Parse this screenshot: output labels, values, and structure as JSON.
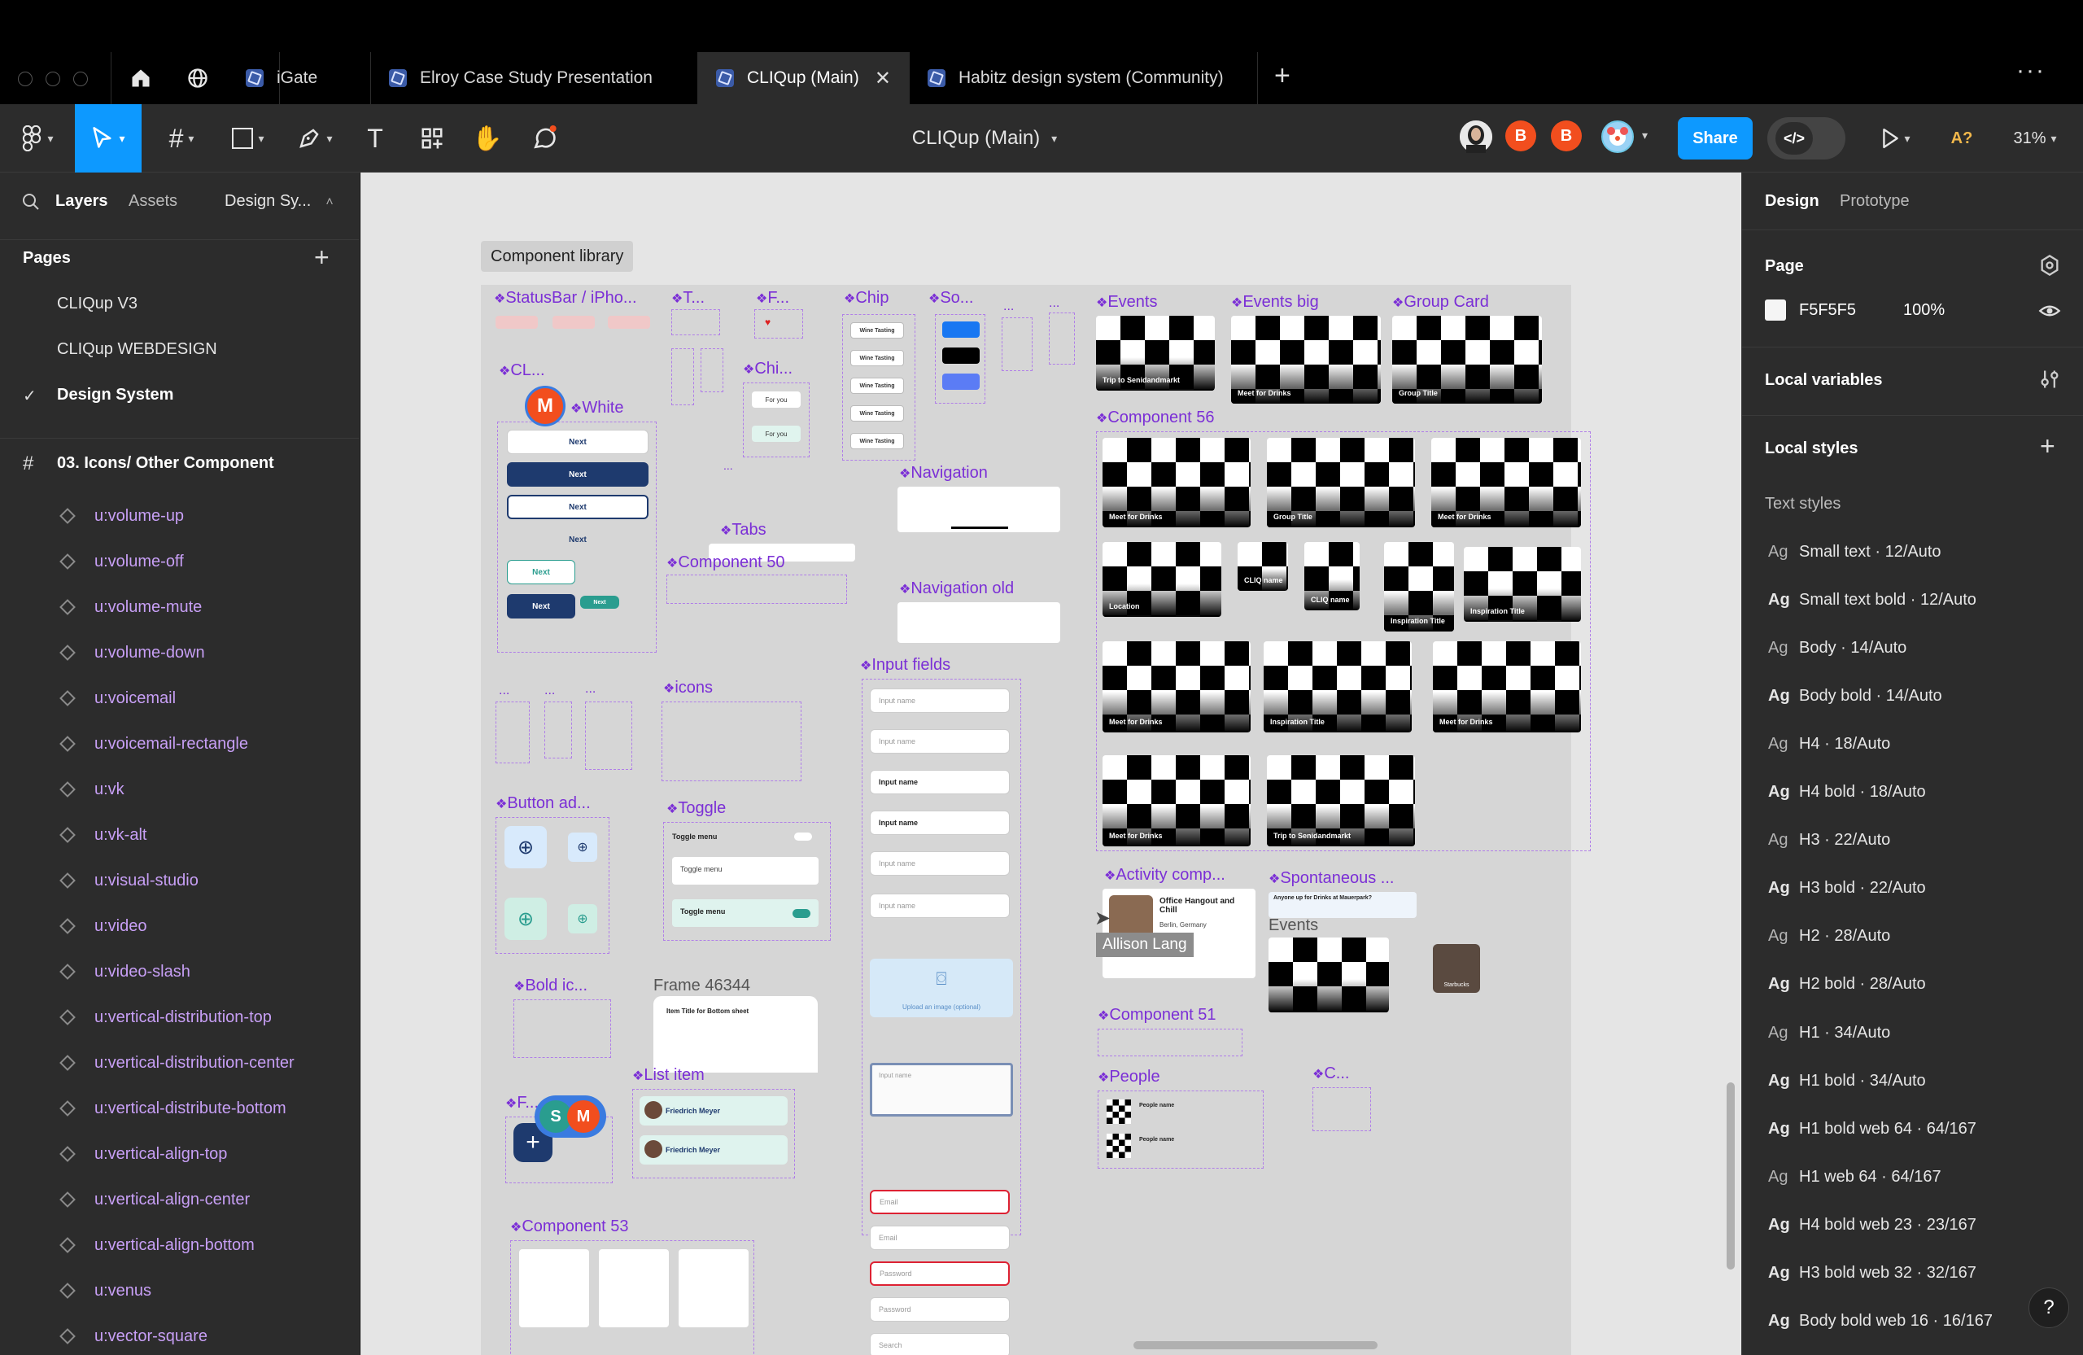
{
  "tabs": [
    {
      "label": "iGate"
    },
    {
      "label": "Elroy Case Study Presentation"
    },
    {
      "label": "CLIQup (Main)",
      "active": true
    },
    {
      "label": "Habitz design system (Community)"
    }
  ],
  "toolbar": {
    "file_title": "CLIQup (Main)",
    "share_label": "Share",
    "zoom": "31%",
    "ai_label": "A?",
    "collaborators": [
      {
        "initial": "B",
        "color": "#f24e1e"
      },
      {
        "initial": "B",
        "color": "#f24e1e"
      }
    ]
  },
  "left_panel": {
    "tabs": {
      "layers": "Layers",
      "assets": "Assets",
      "design_system": "Design Sy..."
    },
    "pages_header": "Pages",
    "pages": [
      "CLIQup V3",
      "CLIQup WEBDESIGN",
      "Design System"
    ],
    "current_page_check": "✓",
    "frame_name": "03. Icons/ Other Component",
    "layers": [
      "u:volume-up",
      "u:volume-off",
      "u:volume-mute",
      "u:volume-down",
      "u:voicemail",
      "u:voicemail-rectangle",
      "u:vk",
      "u:vk-alt",
      "u:visual-studio",
      "u:video",
      "u:video-slash",
      "u:vertical-distribution-top",
      "u:vertical-distribution-center",
      "u:vertical-distribute-bottom",
      "u:vertical-align-top",
      "u:vertical-align-center",
      "u:vertical-align-bottom",
      "u:venus",
      "u:vector-square"
    ]
  },
  "right_panel": {
    "tabs": {
      "design": "Design",
      "prototype": "Prototype"
    },
    "page_section": "Page",
    "page_color": "F5F5F5",
    "page_opacity": "100%",
    "local_variables": "Local variables",
    "local_styles": "Local styles",
    "text_styles_header": "Text styles",
    "text_styles": [
      {
        "name": "Small text · 12/Auto",
        "bold": false
      },
      {
        "name": "Small text bold · 12/Auto",
        "bold": true
      },
      {
        "name": "Body · 14/Auto",
        "bold": false
      },
      {
        "name": "Body bold · 14/Auto",
        "bold": true
      },
      {
        "name": "H4 · 18/Auto",
        "bold": false
      },
      {
        "name": "H4 bold · 18/Auto",
        "bold": true
      },
      {
        "name": "H3 · 22/Auto",
        "bold": false
      },
      {
        "name": "H3 bold · 22/Auto",
        "bold": true
      },
      {
        "name": "H2 · 28/Auto",
        "bold": false
      },
      {
        "name": "H2 bold · 28/Auto",
        "bold": true
      },
      {
        "name": "H1 · 34/Auto",
        "bold": false
      },
      {
        "name": "H1 bold · 34/Auto",
        "bold": true
      },
      {
        "name": "H1 bold web 64 · 64/167",
        "bold": true
      },
      {
        "name": "H1 web 64 · 64/167",
        "bold": false
      },
      {
        "name": "H4 bold web 23 · 23/167",
        "bold": true
      },
      {
        "name": "H3 bold web 32 · 32/167",
        "bold": true
      },
      {
        "name": "Body bold web 16 · 16/167",
        "bold": true
      }
    ],
    "ag": "Ag",
    "help": "?"
  },
  "canvas": {
    "frame_label": "Component library",
    "labels": {
      "statusbar": "StatusBar / iPho...",
      "t": "T...",
      "f": "F...",
      "chip": "Chip",
      "so": "So...",
      "events": "Events",
      "events_big": "Events big",
      "group_card": "Group Card",
      "cl": "CL...",
      "white": "White",
      "chi": "Chi...",
      "component_56": "Component 56",
      "navigation": "Navigation",
      "tabs": "Tabs",
      "component_50": "Component 50",
      "navigation_old": "Navigation old",
      "input_fields": "Input fields",
      "icons": "icons",
      "button_ad": "Button ad...",
      "toggle": "Toggle",
      "activity": "Activity comp...",
      "spontaneous": "Spontaneous ...",
      "bold_ic": "Bold ic...",
      "frame_46344": "Frame 46344",
      "component_51": "Component 51",
      "list_item": "List item",
      "people": "People",
      "c": "C...",
      "component_53": "Component 53",
      "dots": "..."
    },
    "buttons": [
      "Next",
      "Next",
      "Next",
      "Next",
      "Next",
      "Next",
      "Next"
    ],
    "toggles": [
      "Toggle menu",
      "Toggle menu",
      "Toggle menu"
    ],
    "inputs": [
      "Input name",
      "Input name",
      "Input name",
      "Input name",
      "Input name",
      "Input name",
      "Email",
      "Email",
      "Password",
      "Password",
      "Search"
    ],
    "upload_label": "Upload an image (optional)",
    "list_people": [
      "Friedrich Meyer",
      "Friedrich Meyer"
    ],
    "people_rows": [
      "People name",
      "People name"
    ],
    "chips": [
      "Wine Tasting",
      "Wine Tasting",
      "Wine Tasting",
      "Wine Tasting",
      "Wine Tasting"
    ],
    "for_you": [
      "For you",
      "For you"
    ],
    "event_captions": [
      "Trip to Senidandmarkt",
      "Meet for Drinks",
      "Group Title",
      "Meet for Drinks",
      "Group Title",
      "Meet for Drinks",
      "Location",
      "CLIQ name",
      "CLIQ name",
      "Inspiration Title",
      "Inspiration Title",
      "Meet for Drinks",
      "Inspiration Title",
      "Meet for Drinks",
      "Meet for Drinks",
      "Trip to Senidandmarkt"
    ],
    "activity_title": "Office Hangout and Chill",
    "activity_location": "Berlin, Germany",
    "spontaneous_text": "Anyone up for Drinks at Mauerpark?",
    "events_small": "Events",
    "starbucks": "Starbucks",
    "bottom_sheet": "Item Title for Bottom sheet",
    "cursor_user": "Allison Lang",
    "avatar_m": "M",
    "avatar_s": "S"
  }
}
